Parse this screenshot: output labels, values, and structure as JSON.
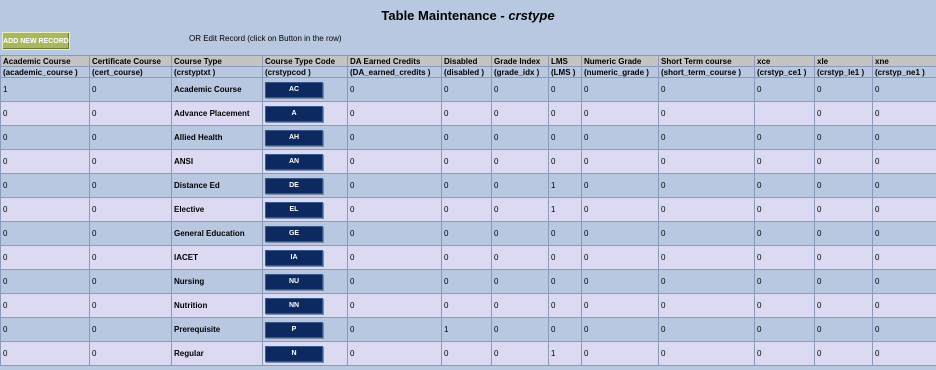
{
  "page": {
    "title_prefix": "Table Maintenance - ",
    "title_table": "crstype"
  },
  "toolbar": {
    "add_label": "ADD NEW RECORD",
    "edit_hint": "OR Edit Record (click on Button in the row)"
  },
  "columns": [
    {
      "label": "Academic Course",
      "field": "(academic_course )"
    },
    {
      "label": "Certificate Course",
      "field": "(cert_course)"
    },
    {
      "label": "Course Type",
      "field": "(crstyptxt )"
    },
    {
      "label": "Course Type Code",
      "field": "(crstypcod )"
    },
    {
      "label": "DA Earned Credits",
      "field": "(DA_earned_credits )"
    },
    {
      "label": "Disabled",
      "field": "(disabled )"
    },
    {
      "label": "Grade Index",
      "field": "(grade_idx )"
    },
    {
      "label": "LMS",
      "field": "(LMS )"
    },
    {
      "label": "Numeric Grade",
      "field": "(numeric_grade )"
    },
    {
      "label": "Short Term course",
      "field": "(short_term_course )"
    },
    {
      "label": "xce",
      "field": "(crstyp_ce1 )"
    },
    {
      "label": "xle",
      "field": "(crstyp_le1 )"
    },
    {
      "label": "xne",
      "field": "(crstyp_ne1 )"
    }
  ],
  "rows": [
    {
      "academic": "1",
      "cert": "0",
      "type": "Academic Course",
      "code": "AC",
      "da": "0",
      "disabled": "0",
      "grade": "0",
      "lms": "0",
      "numeric": "0",
      "short": "0",
      "xce": "0",
      "xle": "0",
      "xne": "0"
    },
    {
      "academic": "0",
      "cert": "0",
      "type": "Advance Placement",
      "code": "A",
      "da": "0",
      "disabled": "0",
      "grade": "0",
      "lms": "0",
      "numeric": "0",
      "short": "0",
      "xce": "",
      "xle": "0",
      "xne": "0"
    },
    {
      "academic": "0",
      "cert": "0",
      "type": "Allied Health",
      "code": "AH",
      "da": "0",
      "disabled": "0",
      "grade": "0",
      "lms": "0",
      "numeric": "0",
      "short": "0",
      "xce": "0",
      "xle": "0",
      "xne": "0"
    },
    {
      "academic": "0",
      "cert": "0",
      "type": "ANSI",
      "code": "AN",
      "da": "0",
      "disabled": "0",
      "grade": "0",
      "lms": "0",
      "numeric": "0",
      "short": "0",
      "xce": "0",
      "xle": "0",
      "xne": "0"
    },
    {
      "academic": "0",
      "cert": "0",
      "type": "Distance Ed",
      "code": "DE",
      "da": "0",
      "disabled": "0",
      "grade": "0",
      "lms": "1",
      "numeric": "0",
      "short": "0",
      "xce": "0",
      "xle": "0",
      "xne": "0"
    },
    {
      "academic": "0",
      "cert": "0",
      "type": "Elective",
      "code": "EL",
      "da": "0",
      "disabled": "0",
      "grade": "0",
      "lms": "1",
      "numeric": "0",
      "short": "0",
      "xce": "0",
      "xle": "0",
      "xne": "0"
    },
    {
      "academic": "0",
      "cert": "0",
      "type": "General Education",
      "code": "GE",
      "da": "0",
      "disabled": "0",
      "grade": "0",
      "lms": "0",
      "numeric": "0",
      "short": "0",
      "xce": "0",
      "xle": "0",
      "xne": "0"
    },
    {
      "academic": "0",
      "cert": "0",
      "type": "IACET",
      "code": "IA",
      "da": "0",
      "disabled": "0",
      "grade": "0",
      "lms": "0",
      "numeric": "0",
      "short": "0",
      "xce": "0",
      "xle": "0",
      "xne": "0"
    },
    {
      "academic": "0",
      "cert": "0",
      "type": "Nursing",
      "code": "NU",
      "da": "0",
      "disabled": "0",
      "grade": "0",
      "lms": "0",
      "numeric": "0",
      "short": "0",
      "xce": "0",
      "xle": "0",
      "xne": "0"
    },
    {
      "academic": "0",
      "cert": "0",
      "type": "Nutrition",
      "code": "NN",
      "da": "0",
      "disabled": "0",
      "grade": "0",
      "lms": "0",
      "numeric": "0",
      "short": "0",
      "xce": "0",
      "xle": "0",
      "xne": "0"
    },
    {
      "academic": "0",
      "cert": "0",
      "type": "Prerequisite",
      "code": "P",
      "da": "0",
      "disabled": "1",
      "grade": "0",
      "lms": "0",
      "numeric": "0",
      "short": "0",
      "xce": "0",
      "xle": "0",
      "xne": "0"
    },
    {
      "academic": "0",
      "cert": "0",
      "type": "Regular",
      "code": "N",
      "da": "0",
      "disabled": "0",
      "grade": "0",
      "lms": "1",
      "numeric": "0",
      "short": "0",
      "xce": "0",
      "xle": "0",
      "xne": "0"
    }
  ],
  "colors": {
    "background": "#b8c8e0",
    "header": "#c4c4c4",
    "row_alt": "#dcdaf2",
    "code_button": "#0c2a60",
    "add_button": "#a8b860"
  }
}
